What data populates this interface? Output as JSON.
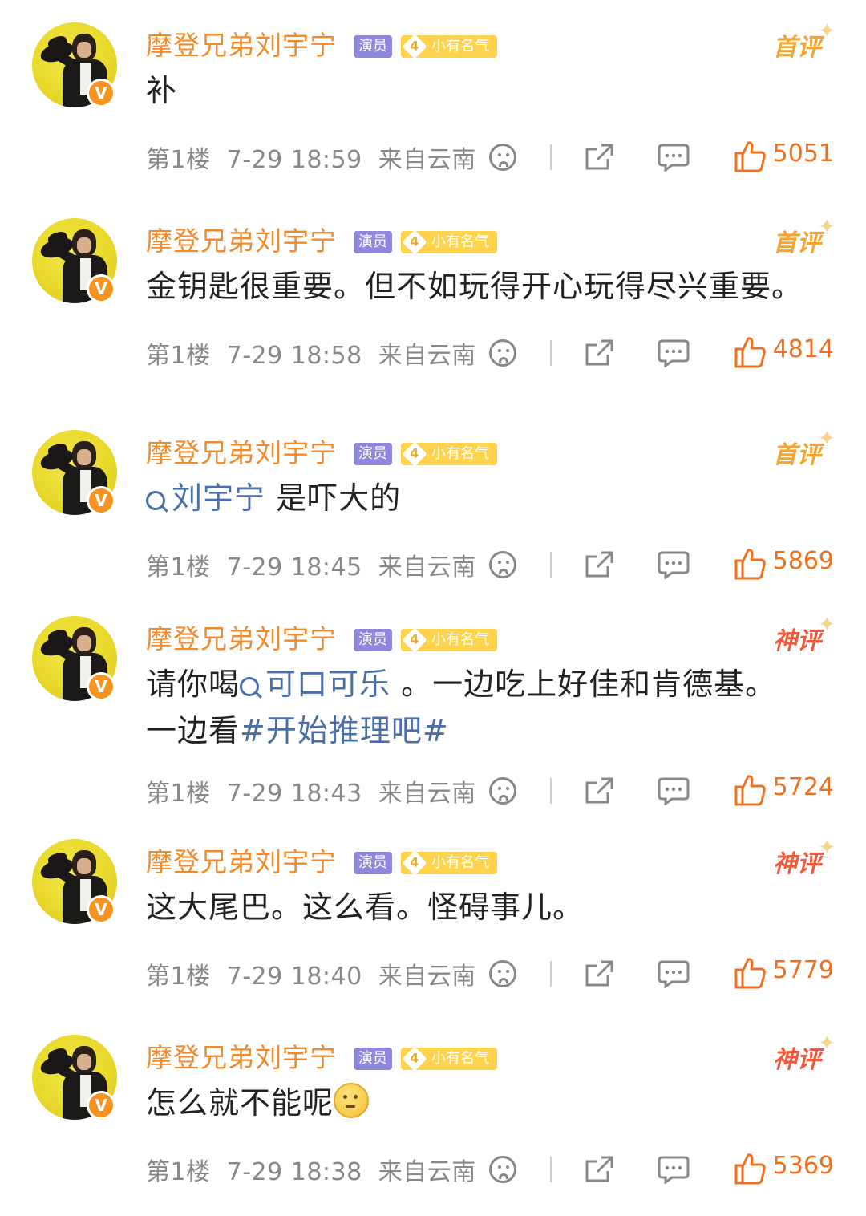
{
  "user": {
    "name": "摩登兄弟刘宇宁",
    "role_tag": "演员",
    "level": "4",
    "level_tag": "小有名气"
  },
  "comments": [
    {
      "rank": "首评",
      "text_segments": [
        {
          "t": "补",
          "link": false
        }
      ],
      "floor": "第1楼",
      "time": "7-29 18:59",
      "location": "来自云南",
      "likes": "5051"
    },
    {
      "rank": "首评",
      "text_segments": [
        {
          "t": "金钥匙很重要。但不如玩得开心玩得尽兴重要。",
          "link": false
        }
      ],
      "floor": "第1楼",
      "time": "7-29 18:58",
      "location": "来自云南",
      "likes": "4814"
    },
    {
      "rank": "首评",
      "text_segments": [
        {
          "t": "刘宇宁",
          "link": true,
          "search": true
        },
        {
          "t": " 是吓大的",
          "link": false
        }
      ],
      "floor": "第1楼",
      "time": "7-29 18:45",
      "location": "来自云南",
      "likes": "5869"
    },
    {
      "rank": "神评",
      "text_segments": [
        {
          "t": "请你喝",
          "link": false
        },
        {
          "t": "可口可乐",
          "link": true,
          "search": true
        },
        {
          "t": " 。一边吃上好佳和肯德基。",
          "link": false
        }
      ],
      "text_line2": [
        {
          "t": "一边看",
          "link": false
        },
        {
          "t": "#开始推理吧#",
          "link": true
        }
      ],
      "floor": "第1楼",
      "time": "7-29 18:43",
      "location": "来自云南",
      "likes": "5724"
    },
    {
      "rank": "神评",
      "text_segments": [
        {
          "t": "这大尾巴。这么看。怪碍事儿。",
          "link": false
        }
      ],
      "floor": "第1楼",
      "time": "7-29 18:40",
      "location": "来自云南",
      "likes": "5779"
    },
    {
      "rank": "神评",
      "text_segments": [
        {
          "t": "怎么就不能呢",
          "link": false
        }
      ],
      "emoji": "thinking-emoji",
      "floor": "第1楼",
      "time": "7-29 18:38",
      "location": "来自云南",
      "likes": "5369"
    }
  ],
  "icons": {
    "dislike": "sad-face-icon",
    "share": "share-icon",
    "reply": "comment-icon",
    "like": "thumbs-up-icon",
    "verified": "verified-v-icon",
    "search": "search-icon"
  },
  "colors": {
    "username": "#f28a2a",
    "link": "#4a6fa8",
    "like_count": "#f07020",
    "meta": "#888888",
    "rank_first": "#f5a52f",
    "rank_god": "#ef5a3d"
  }
}
